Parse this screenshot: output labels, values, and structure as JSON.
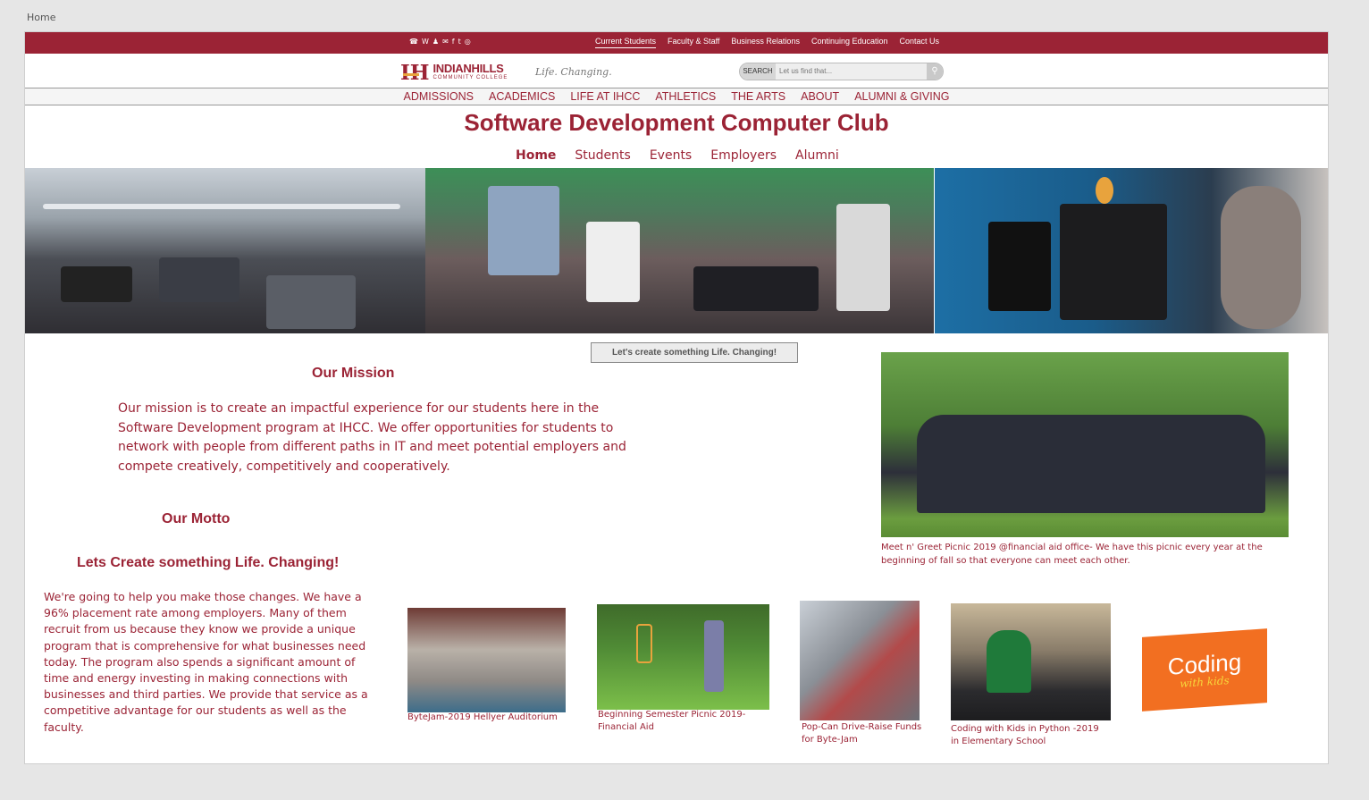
{
  "breadcrumb": "Home",
  "topbar": {
    "social_icons": [
      "phone-icon",
      "web-icon",
      "person-icon",
      "mail-icon",
      "facebook-icon",
      "twitter-icon",
      "instagram-icon"
    ],
    "social_glyphs": [
      "☎",
      "W",
      "♟",
      "✉",
      "f",
      "t",
      "◎"
    ],
    "links": [
      "Current Students",
      "Faculty & Staff",
      "Business Relations",
      "Continuing Education",
      "Contact Us"
    ]
  },
  "header": {
    "logo_mark": "IH",
    "logo_name": "INDIANHILLS",
    "logo_sub": "COMMUNITY COLLEGE",
    "tagline": "Life. Changing.",
    "search_label": "SEARCH",
    "search_placeholder": "Let us find that...",
    "search_icon": "⚲"
  },
  "main_nav": [
    "ADMISSIONS",
    "ACADEMICS",
    "LIFE AT IHCC",
    "ATHLETICS",
    "THE ARTS",
    "ABOUT",
    "ALUMNI & GIVING"
  ],
  "site_title": "Software Development Computer Club",
  "sub_nav": [
    "Home",
    "Students",
    "Events",
    "Employers",
    "Alumni"
  ],
  "cta_button": "Let's create something Life. Changing!",
  "mission": {
    "heading": "Our Mission",
    "text": "Our mission is to create an impactful experience for our students here in the Software Development program at IHCC. We offer opportunities for students to network with people from different paths in IT and meet potential employers and compete creatively, competitively and cooperatively."
  },
  "motto": {
    "heading": "Our Motto",
    "subheading": "Lets Create something Life. Changing!",
    "text": "We're going to help you make those changes. We have a 96% placement rate among employers. Many of them recruit from us because they know we provide a unique program that is comprehensive for what businesses need today.  The program also spends a significant amount of time and energy investing in making connections with businesses and third parties. We provide that service as a competitive advantage for our students as well as the faculty."
  },
  "picnic_caption": "Meet n' Greet Picnic 2019 @financial aid office- We have this picnic every year at the beginning of fall so that everyone can meet each other.",
  "gallery": [
    {
      "caption": "ByteJam-2019 Hellyer Auditorium"
    },
    {
      "caption": "Beginning Semester Picnic 2019-Financial Aid"
    },
    {
      "caption": "Pop-Can Drive-Raise Funds for Byte-Jam"
    },
    {
      "caption": "Coding with Kids in Python -2019  in Elementary School"
    }
  ],
  "coding_logo": {
    "line1": "Coding",
    "line2": "with kids"
  },
  "colors": {
    "brand": "#9b2335",
    "accent": "#e8a33d",
    "coding_orange": "#f26f21"
  }
}
